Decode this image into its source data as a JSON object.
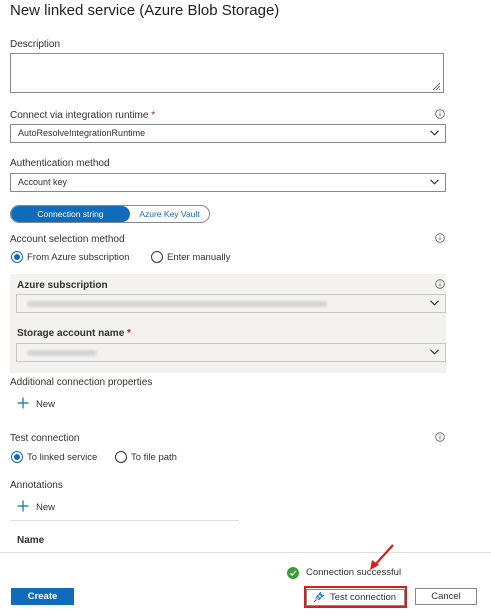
{
  "header": {
    "title": "New linked service (Azure Blob Storage)"
  },
  "description": {
    "label": "Description",
    "value": ""
  },
  "runtime": {
    "label": "Connect via integration runtime",
    "required_mark": "*",
    "value": "AutoResolveIntegrationRuntime"
  },
  "auth": {
    "label": "Authentication method",
    "value": "Account key"
  },
  "pivot": {
    "tabs": [
      "Connection string",
      "Azure Key Vault"
    ],
    "selected": "Connection string"
  },
  "account_selection": {
    "label": "Account selection method",
    "options": [
      "From Azure subscription",
      "Enter manually"
    ],
    "selected": "From Azure subscription"
  },
  "subscription": {
    "label": "Azure subscription",
    "value": ""
  },
  "storage_account": {
    "label": "Storage account name",
    "required_mark": "*",
    "value": ""
  },
  "additional": {
    "label": "Additional connection properties",
    "new_label": "New"
  },
  "test_connection": {
    "label": "Test connection",
    "options": [
      "To linked service",
      "To file path"
    ],
    "selected": "To linked service"
  },
  "annotations": {
    "label": "Annotations",
    "new_label": "New",
    "column_header": "Name"
  },
  "status": {
    "text": "Connection successful",
    "color": "#107c10"
  },
  "footer": {
    "create_label": "Create",
    "test_label": "Test connection",
    "cancel_label": "Cancel"
  },
  "colors": {
    "primary": "#0f6cbd",
    "highlight": "#d61e1e",
    "success": "#107c10"
  }
}
